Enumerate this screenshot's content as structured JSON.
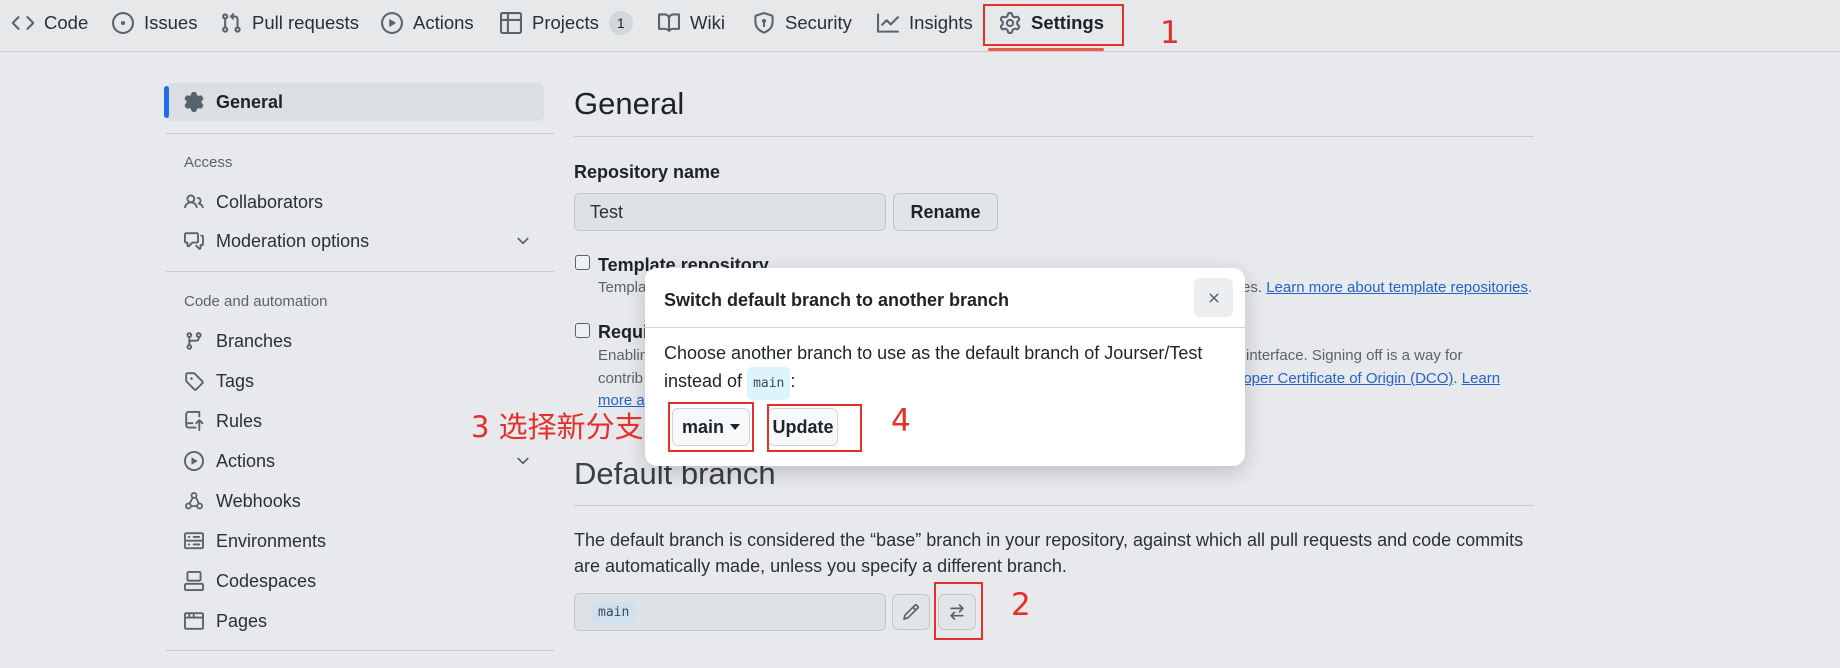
{
  "nav": {
    "tabs": [
      {
        "label": "Code",
        "icon": "code-icon"
      },
      {
        "label": "Issues",
        "icon": "issue-icon"
      },
      {
        "label": "Pull requests",
        "icon": "pull-request-icon"
      },
      {
        "label": "Actions",
        "icon": "play-icon"
      },
      {
        "label": "Projects",
        "icon": "table-icon",
        "counter": "1"
      },
      {
        "label": "Wiki",
        "icon": "book-icon"
      },
      {
        "label": "Security",
        "icon": "shield-icon"
      },
      {
        "label": "Insights",
        "icon": "graph-icon"
      },
      {
        "label": "Settings",
        "icon": "gear-icon",
        "selected": true
      }
    ]
  },
  "sidebar": {
    "general": "General",
    "access_heading": "Access",
    "access_items": [
      {
        "label": "Collaborators",
        "icon": "people-icon"
      },
      {
        "label": "Moderation options",
        "icon": "comment-discussion-icon"
      }
    ],
    "code_heading": "Code and automation",
    "code_items": [
      {
        "label": "Branches",
        "icon": "git-branch-icon"
      },
      {
        "label": "Tags",
        "icon": "tag-icon"
      },
      {
        "label": "Rules",
        "icon": "repo-push-icon"
      },
      {
        "label": "Actions",
        "icon": "play-icon"
      },
      {
        "label": "Webhooks",
        "icon": "webhook-icon"
      },
      {
        "label": "Environments",
        "icon": "server-icon"
      },
      {
        "label": "Codespaces",
        "icon": "codespaces-icon"
      },
      {
        "label": "Pages",
        "icon": "browser-icon"
      }
    ]
  },
  "main": {
    "title": "General",
    "repo_name_label": "Repository name",
    "repo_name_value": "Test",
    "rename_button": "Rename",
    "template_label": "Template repository",
    "template_desc_start": "Templa",
    "template_desc_end": "es.",
    "template_link": "Learn more about template repositories",
    "signoff_label": "Requi",
    "signoff_line1_start": "Enablin",
    "signoff_line1_end": "interface. Signing off is a way for",
    "signoff_line2_start": "contrib",
    "signoff_line2_link": "loper Certificate of Origin (DCO)",
    "signoff_line2_after": ".",
    "signoff_line2_learn": "Learn",
    "signoff_line3_link": "more a",
    "default_branch_title": "Default branch",
    "default_branch_desc": "The default branch is considered the “base” branch in your repository, against which all pull requests and code commits are automatically made, unless you specify a different branch.",
    "default_branch_value": "main"
  },
  "modal": {
    "title": "Switch default branch to another branch",
    "body_text": "Choose another branch to use as the default branch of Jourser/Test instead of",
    "body_code": "main",
    "body_end": ":",
    "branch_select": "main",
    "update_button": "Update"
  },
  "annotations": {
    "step1": "1",
    "step2": "2",
    "step3": "3 选择新分支",
    "step4": "4",
    "color": "#e3302b"
  },
  "colors": {
    "accent": "#1f6feb",
    "link": "#2563c9",
    "page_bg": "#e7e9ec"
  }
}
